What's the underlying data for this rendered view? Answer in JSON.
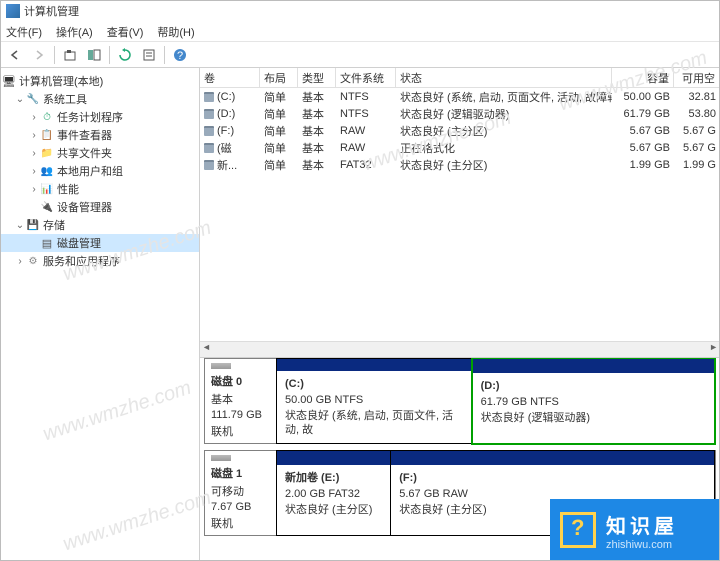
{
  "window": {
    "title": "计算机管理"
  },
  "menu": {
    "file": "文件(F)",
    "action": "操作(A)",
    "view": "查看(V)",
    "help": "帮助(H)"
  },
  "tree": {
    "root": "计算机管理(本地)",
    "systools": "系统工具",
    "sched": "任务计划程序",
    "event": "事件查看器",
    "shared": "共享文件夹",
    "users": "本地用户和组",
    "perf": "性能",
    "devmgr": "设备管理器",
    "storage": "存储",
    "diskmgmt": "磁盘管理",
    "services": "服务和应用程序"
  },
  "cols": {
    "vol": "卷",
    "layout": "布局",
    "type": "类型",
    "fs": "文件系统",
    "status": "状态",
    "cap": "容量",
    "free": "可用空"
  },
  "vols": [
    {
      "name": "(C:)",
      "layout": "简单",
      "type": "基本",
      "fs": "NTFS",
      "status": "状态良好 (系统, 启动, 页面文件, 活动, 故障转储, 主分区)",
      "cap": "50.00 GB",
      "free": "32.81"
    },
    {
      "name": "(D:)",
      "layout": "简单",
      "type": "基本",
      "fs": "NTFS",
      "status": "状态良好 (逻辑驱动器)",
      "cap": "61.79 GB",
      "free": "53.80"
    },
    {
      "name": "(F:)",
      "layout": "简单",
      "type": "基本",
      "fs": "RAW",
      "status": "状态良好 (主分区)",
      "cap": "5.67 GB",
      "free": "5.67 G"
    },
    {
      "name": "(磁",
      "layout": "简单",
      "type": "基本",
      "fs": "RAW",
      "status": "正在格式化",
      "cap": "5.67 GB",
      "free": "5.67 G"
    },
    {
      "name": "新...",
      "layout": "简单",
      "type": "基本",
      "fs": "FAT32",
      "status": "状态良好 (主分区)",
      "cap": "1.99 GB",
      "free": "1.99 G"
    }
  ],
  "disk0": {
    "title": "磁盘 0",
    "type": "基本",
    "size": "111.79 GB",
    "state": "联机",
    "c": {
      "label": "(C:)",
      "info": "50.00 GB NTFS",
      "status": "状态良好 (系统, 启动, 页面文件, 活动, 故"
    },
    "d": {
      "label": "(D:)",
      "info": "61.79 GB NTFS",
      "status": "状态良好 (逻辑驱动器)"
    }
  },
  "disk1": {
    "title": "磁盘 1",
    "type": "可移动",
    "size": "7.67 GB",
    "state": "联机",
    "e": {
      "label": "新加卷 (E:)",
      "info": "2.00 GB FAT32",
      "status": "状态良好 (主分区)"
    },
    "f": {
      "label": "(F:)",
      "info": "5.67 GB RAW",
      "status": "状态良好 (主分区)"
    }
  },
  "logo": {
    "name": "知识屋",
    "url": "zhishiwu.com"
  },
  "watermark": "www.wmzhe.com"
}
